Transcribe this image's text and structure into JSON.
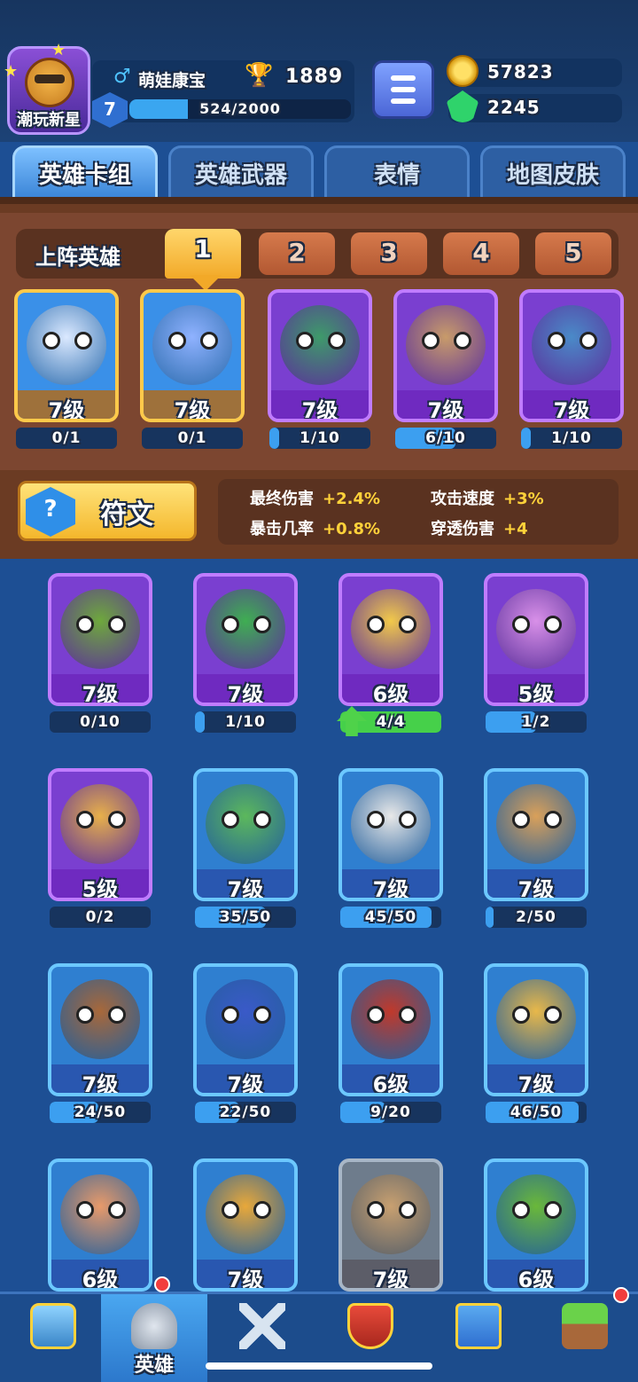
{
  "player": {
    "avatar_title": "潮玩新星",
    "name": "萌娃康宝",
    "trophies": "1889",
    "level": "7",
    "xp_text": "524/2000",
    "xp_progress": 0.262
  },
  "currency": {
    "gold": "57823",
    "gems": "2245"
  },
  "tabs": [
    {
      "label": "英雄卡组",
      "active": true
    },
    {
      "label": "英雄武器",
      "active": false
    },
    {
      "label": "表情",
      "active": false
    },
    {
      "label": "地图皮肤",
      "active": false
    }
  ],
  "lineup": {
    "label": "上阵英雄",
    "slots": [
      "1",
      "2",
      "3",
      "4",
      "5"
    ],
    "active_slot": "1"
  },
  "lineup_heroes": [
    {
      "rarity": "legend",
      "level": "7级",
      "progress_text": "0/1",
      "progress": 0,
      "color": "#dbe9ff",
      "icon": "yeti-hero-icon"
    },
    {
      "rarity": "legend",
      "level": "7级",
      "progress_text": "0/1",
      "progress": 0,
      "color": "#8fb2ff",
      "icon": "ice-wizard-hero-icon"
    },
    {
      "rarity": "rare",
      "level": "7级",
      "progress_text": "1/10",
      "progress": 0.1,
      "color": "#3e9a6a",
      "icon": "masked-bandit-hero-icon"
    },
    {
      "rarity": "rare",
      "level": "7级",
      "progress_text": "6/10",
      "progress": 0.6,
      "color": "#c89b6a",
      "icon": "hooded-mage-hero-icon"
    },
    {
      "rarity": "rare",
      "level": "7级",
      "progress_text": "1/10",
      "progress": 0.1,
      "color": "#4a8ac8",
      "icon": "thief-hero-icon"
    }
  ],
  "rune": {
    "label": "符文",
    "icon_glyph": "?"
  },
  "stats": [
    {
      "name": "最终伤害",
      "value": "+2.4%"
    },
    {
      "name": "攻击速度",
      "value": "+3%"
    },
    {
      "name": "暴击几率",
      "value": "+0.8%"
    },
    {
      "name": "穿透伤害",
      "value": "+4"
    }
  ],
  "collection_heroes": [
    {
      "rarity": "rare",
      "level": "7级",
      "progress_text": "0/10",
      "progress": 0,
      "color": "#6ea83c",
      "icon": "ranger-hero-icon"
    },
    {
      "rarity": "rare",
      "level": "7级",
      "progress_text": "1/10",
      "progress": 0.1,
      "color": "#3fae52",
      "icon": "robot-hero-icon"
    },
    {
      "rarity": "rare",
      "level": "6级",
      "progress_text": "4/4",
      "progress": 1,
      "color": "#f2c94a",
      "icon": "astronaut-hero-icon",
      "upgrade": true
    },
    {
      "rarity": "rare",
      "level": "5级",
      "progress_text": "1/2",
      "progress": 0.5,
      "color": "#d890e8",
      "icon": "octopus-hero-icon"
    },
    {
      "rarity": "rare",
      "level": "5级",
      "progress_text": "0/2",
      "progress": 0,
      "color": "#e8b04a",
      "icon": "explorer-hero-icon"
    },
    {
      "rarity": "normal",
      "level": "7级",
      "progress_text": "35/50",
      "progress": 0.7,
      "color": "#5cb85c",
      "icon": "detective-hero-icon"
    },
    {
      "rarity": "normal",
      "level": "7级",
      "progress_text": "45/50",
      "progress": 0.9,
      "color": "#e8e8e8",
      "icon": "mummy-hero-icon"
    },
    {
      "rarity": "normal",
      "level": "7级",
      "progress_text": "2/50",
      "progress": 0.04,
      "color": "#d9a05a",
      "icon": "caveman-hero-icon"
    },
    {
      "rarity": "normal",
      "level": "7级",
      "progress_text": "24/50",
      "progress": 0.48,
      "color": "#a8683a",
      "icon": "bear-hero-icon"
    },
    {
      "rarity": "normal",
      "level": "7级",
      "progress_text": "22/50",
      "progress": 0.44,
      "color": "#3a5ac8",
      "icon": "helmet-hero-icon"
    },
    {
      "rarity": "normal",
      "level": "6级",
      "progress_text": "9/20",
      "progress": 0.45,
      "color": "#c0392b",
      "icon": "cowboy-hero-icon"
    },
    {
      "rarity": "normal",
      "level": "7级",
      "progress_text": "46/50",
      "progress": 0.92,
      "color": "#e8b84a",
      "icon": "gunslinger-hero-icon"
    },
    {
      "rarity": "normal",
      "level": "6级",
      "progress_text": "",
      "progress": 0,
      "color": "#e89a6a",
      "icon": "panda-hero-icon"
    },
    {
      "rarity": "normal",
      "level": "7级",
      "progress_text": "",
      "progress": 0,
      "color": "#e8a83a",
      "icon": "knight-hero-icon"
    },
    {
      "rarity": "common",
      "level": "7级",
      "progress_text": "",
      "progress": 0,
      "color": "#c8a070",
      "icon": "ogre-hero-icon"
    },
    {
      "rarity": "normal",
      "level": "6级",
      "progress_text": "",
      "progress": 0,
      "color": "#6ab83a",
      "icon": "elf-archer-hero-icon"
    }
  ],
  "bottom_nav": [
    {
      "icon": "treasure-chest-icon",
      "label": "",
      "active": false
    },
    {
      "icon": "knight-helmet-icon",
      "label": "英雄",
      "active": true,
      "notification": true
    },
    {
      "icon": "crossed-swords-icon",
      "label": "",
      "active": false
    },
    {
      "icon": "crown-shield-icon",
      "label": "",
      "active": false
    },
    {
      "icon": "team-banner-icon",
      "label": "",
      "active": false
    },
    {
      "icon": "sprout-island-icon",
      "label": "",
      "active": false,
      "notification": true
    }
  ],
  "colors": {
    "background": "#1d4f94",
    "wood_panel": "#7c4630",
    "gold_accent": "#ffd23a",
    "progress_blue": "#3c9ff0",
    "upgrade_green": "#46d04a"
  }
}
